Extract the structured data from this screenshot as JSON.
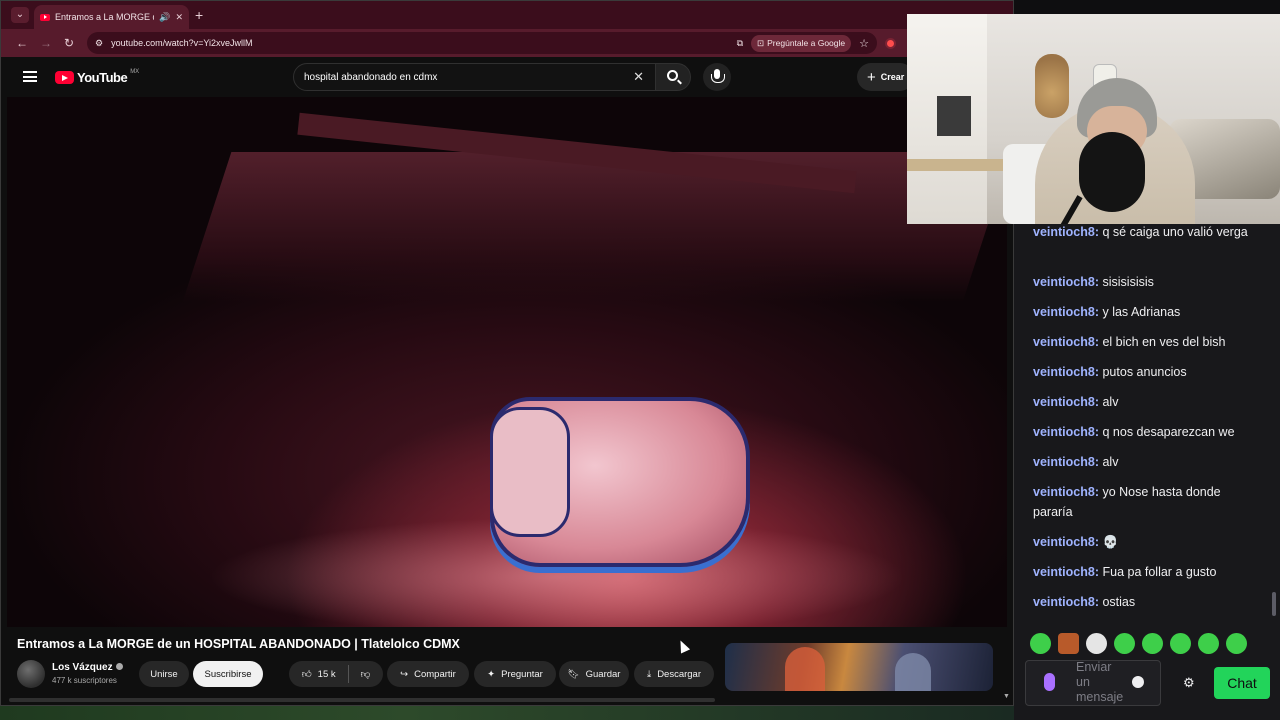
{
  "browser": {
    "tab_title": "Entramos a La MORGE de u",
    "url": "youtube.com/watch?v=Yi2xveJwllM",
    "google_button": "Pregúntale a Google"
  },
  "youtube": {
    "logo_text": "YouTube",
    "region": "MX",
    "search_query": "hospital abandonado en cdmx",
    "create_label": "Crear"
  },
  "video": {
    "title": "Entramos a La MORGE de un HOSPITAL ABANDONADO | Tlatelolco CDMX",
    "channel_name": "Los Vázquez",
    "subscribers": "477 k suscriptores",
    "join_label": "Unirse",
    "subscribe_label": "Suscribirse",
    "like_count": "15 k",
    "share_label": "Compartir",
    "ask_label": "Preguntar",
    "save_label": "Guardar",
    "download_label": "Descargar"
  },
  "chat": {
    "messages": [
      {
        "user": "veintioch8:",
        "text": "q sé caiga uno valió verga"
      },
      {
        "user": "veintioch8:",
        "text": "sisisisisis"
      },
      {
        "user": "veintioch8:",
        "text": "y las Adrianas"
      },
      {
        "user": "veintioch8:",
        "text": "el bich en ves del bish"
      },
      {
        "user": "veintioch8:",
        "text": "putos anuncios"
      },
      {
        "user": "veintioch8:",
        "text": "alv"
      },
      {
        "user": "veintioch8:",
        "text": "q nos desaparezcan we"
      },
      {
        "user": "veintioch8:",
        "text": "alv"
      },
      {
        "user": "veintioch8:",
        "text": "yo Nose hasta donde pararía"
      },
      {
        "user": "veintioch8:",
        "text": "💀"
      },
      {
        "user": "veintioch8:",
        "text": "Fua pa follar a gusto"
      },
      {
        "user": "veintioch8:",
        "text": "ostias"
      }
    ],
    "input_placeholder": "Enviar un mensaje",
    "send_label": "Chat",
    "accent_color": "#22d45a",
    "username_color": "#9fb3ff"
  }
}
